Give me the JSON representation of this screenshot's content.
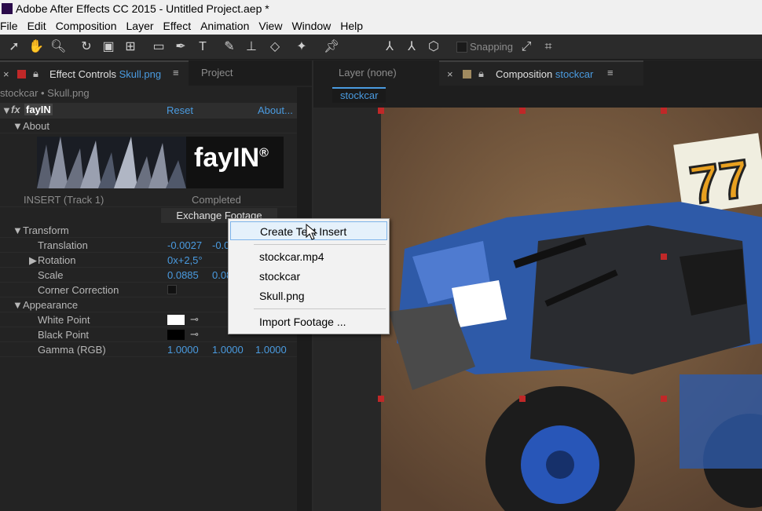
{
  "window": {
    "title": "Adobe After Effects CC 2015 - Untitled Project.aep *"
  },
  "menubar": [
    "File",
    "Edit",
    "Composition",
    "Layer",
    "Effect",
    "Animation",
    "View",
    "Window",
    "Help"
  ],
  "toolbar": {
    "snapping_label": "Snapping"
  },
  "left_panel": {
    "tab_effect_controls_prefix": "Effect Controls ",
    "tab_effect_controls_layer": "Skull.png",
    "tab_project": "Project",
    "breadcrumb": "stockcar • Skull.png",
    "effect_name": "fayIN",
    "reset_label": "Reset",
    "about_link": "About...",
    "about_section": "About",
    "logo_text": "fayIN",
    "logo_mark": "®",
    "insert_label": "INSERT  (Track 1)",
    "insert_status": "Completed",
    "exchange_button": "Exchange Footage",
    "transform_section": "Transform",
    "translation_label": "Translation",
    "translation_x": "-0.0027",
    "translation_y": "-0.0",
    "rotation_label": "Rotation",
    "rotation_value": "0x+2,5°",
    "scale_label": "Scale",
    "scale_x": "0.0885",
    "scale_y": "0.08",
    "corner_correction_label": "Corner Correction",
    "appearance_section": "Appearance",
    "white_point_label": "White Point",
    "black_point_label": "Black Point",
    "gamma_label": "Gamma (RGB)",
    "gamma_r": "1.0000",
    "gamma_g": "1.0000",
    "gamma_b": "1.0000"
  },
  "right_panel": {
    "tab_layer": "Layer (none)",
    "tab_composition_prefix": "Composition ",
    "tab_composition_name": "stockcar",
    "subtab": "stockcar"
  },
  "context_menu": {
    "items": [
      "Create Text Insert",
      "stockcar.mp4",
      "stockcar",
      "Skull.png",
      "Import Footage ..."
    ],
    "highlighted": "Create Text Insert"
  },
  "colors": {
    "accent_blue": "#4a9be0",
    "label_red": "#c02828"
  }
}
